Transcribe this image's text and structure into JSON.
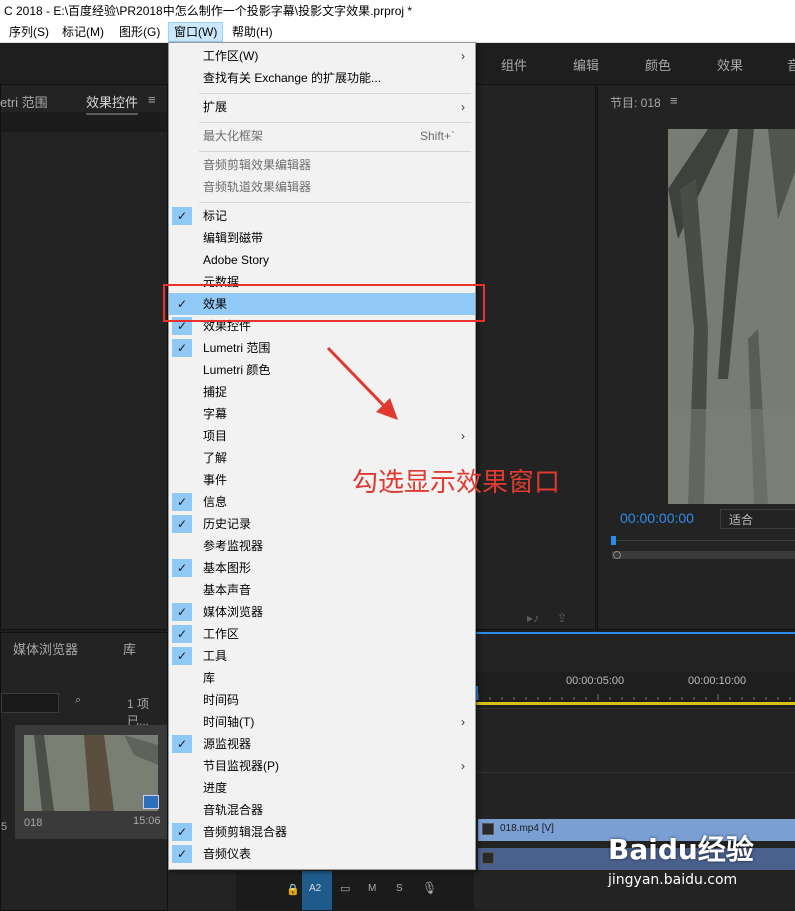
{
  "titlebar": {
    "text": "C 2018 - E:\\百度经验\\PR2018中怎么制作一个投影字幕\\投影文字效果.prproj *"
  },
  "menubar": {
    "items": [
      "序列(S)",
      "标记(M)",
      "图形(G)",
      "窗口(W)",
      "帮助(H)"
    ]
  },
  "workspace_tabs": [
    "组件",
    "编辑",
    "颜色",
    "效果",
    "音"
  ],
  "source_panel": {
    "tab_left": "etri 范围",
    "tab_active": "效果控件"
  },
  "program_monitor": {
    "title": "节目: 018",
    "timecode": "00:00:00:00",
    "fit": "适合"
  },
  "project_panel": {
    "tab_media": "媒体浏览器",
    "tab_lib": "库",
    "items_count": "1 项已...",
    "clip_name": "018",
    "clip_duration": "15:06",
    "side_num": "5"
  },
  "timeline": {
    "times": [
      "00:00:05:00",
      "00:00:10:00"
    ],
    "clip_label": "018.mp4 [V]",
    "track_label": "A2"
  },
  "menu": {
    "items": [
      {
        "label": "工作区(W)",
        "arrow": true
      },
      {
        "label": "查找有关 Exchange 的扩展功能..."
      },
      {
        "label": "扩展",
        "arrow": true
      },
      {
        "label": "最大化框架",
        "shortcut": "Shift+`",
        "disabled": true
      },
      {
        "label": "音频剪辑效果编辑器",
        "disabled": true
      },
      {
        "label": "音频轨道效果编辑器",
        "disabled": true
      },
      {
        "label": "标记",
        "checked": true
      },
      {
        "label": "编辑到磁带"
      },
      {
        "label": "Adobe Story"
      },
      {
        "label": "元数据"
      },
      {
        "label": "效果",
        "checked": true,
        "highlighted": true
      },
      {
        "label": "效果控件",
        "checked": true
      },
      {
        "label": "Lumetri 范围",
        "checked": true
      },
      {
        "label": "Lumetri 颜色"
      },
      {
        "label": "捕捉"
      },
      {
        "label": "字幕"
      },
      {
        "label": "项目",
        "arrow": true
      },
      {
        "label": "了解"
      },
      {
        "label": "事件"
      },
      {
        "label": "信息",
        "checked": true
      },
      {
        "label": "历史记录",
        "checked": true
      },
      {
        "label": "参考监视器"
      },
      {
        "label": "基本图形",
        "checked": true
      },
      {
        "label": "基本声音"
      },
      {
        "label": "媒体浏览器",
        "checked": true
      },
      {
        "label": "工作区",
        "checked": true
      },
      {
        "label": "工具",
        "checked": true
      },
      {
        "label": "库"
      },
      {
        "label": "时间码"
      },
      {
        "label": "时间轴(T)",
        "arrow": true
      },
      {
        "label": "源监视器",
        "checked": true
      },
      {
        "label": "节目监视器(P)",
        "arrow": true
      },
      {
        "label": "进度"
      },
      {
        "label": "音轨混合器"
      },
      {
        "label": "音频剪辑混合器",
        "checked": true
      },
      {
        "label": "音频仪表",
        "checked": true
      }
    ]
  },
  "annotation": {
    "text": "勾选显示效果窗口",
    "color": "#e03a30"
  },
  "watermark": {
    "logo": "Baidu经验",
    "url": "jingyan.baidu.com"
  },
  "colors": {
    "menu_highlight": "#91c9f7",
    "checkbox": "#90c8f6",
    "timecode_blue": "#2d8ceb",
    "clip_blue": "#7a9fd3"
  }
}
